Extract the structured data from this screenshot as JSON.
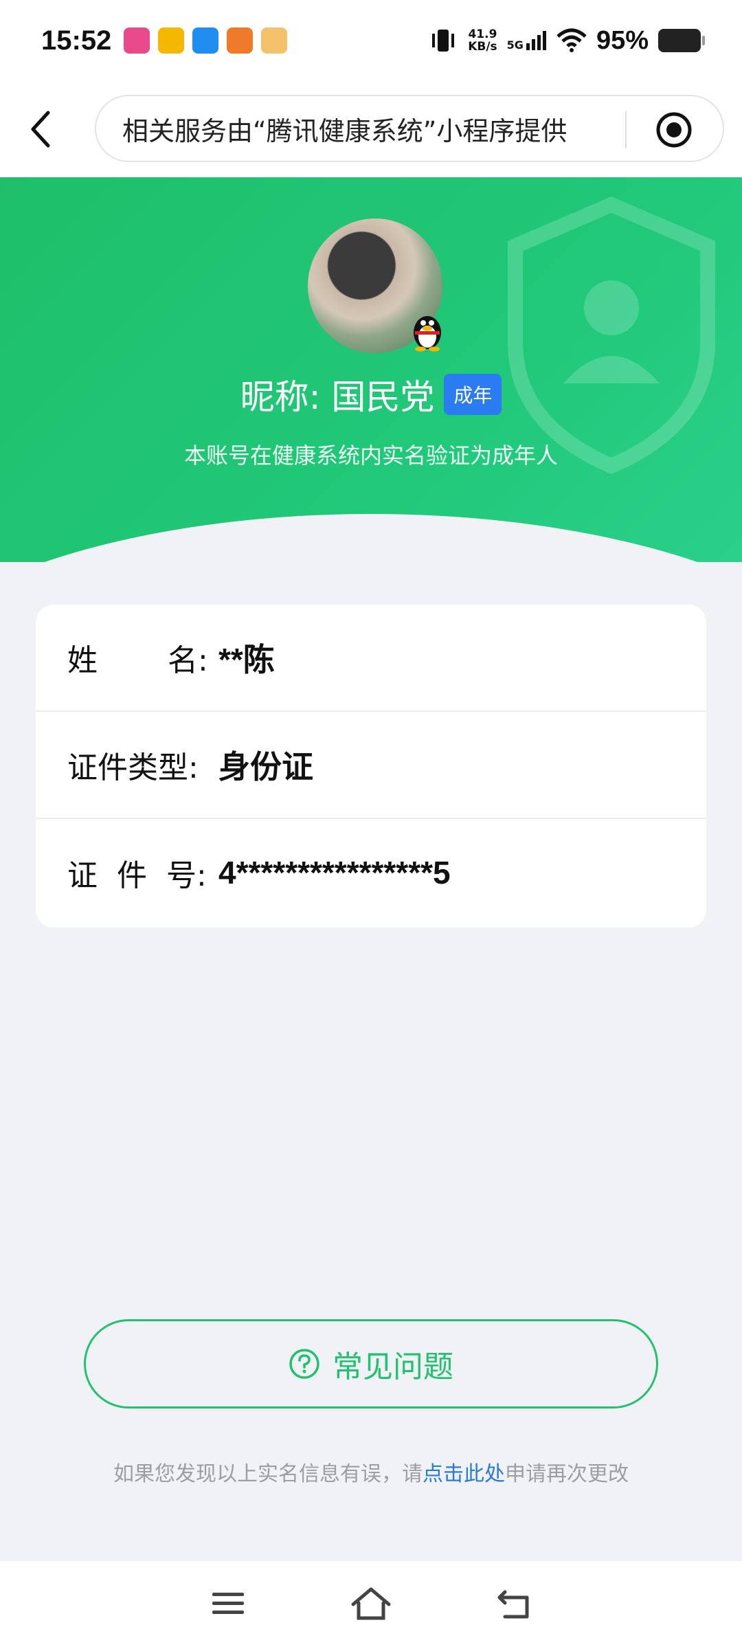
{
  "status_bar": {
    "time": "15:52",
    "net_speed_value": "41.9",
    "net_speed_unit": "KB/s",
    "network": "5G",
    "battery_pct": "95%"
  },
  "nav": {
    "notice": "相关服务由“腾讯健康系统”小程序提供"
  },
  "profile": {
    "nickname": "昵称: 国民党",
    "badge": "成年",
    "verify_note": "本账号在健康系统内实名验证为成年人"
  },
  "info": {
    "rows": [
      {
        "label": "姓　　 名:",
        "value": "**陈"
      },
      {
        "label": "证件类型:",
        "value": "身份证"
      },
      {
        "label": "证  件  号:",
        "value": "4****************5"
      }
    ]
  },
  "faq": {
    "label": "常见问题"
  },
  "footer": {
    "prefix": "如果您发现以上实名信息有误，请",
    "link": "点击此处",
    "suffix": "申请再次更改"
  },
  "colors": {
    "accent_green": "#21c16f",
    "badge_blue": "#2b7cf0",
    "link_blue": "#2a7ad8"
  }
}
